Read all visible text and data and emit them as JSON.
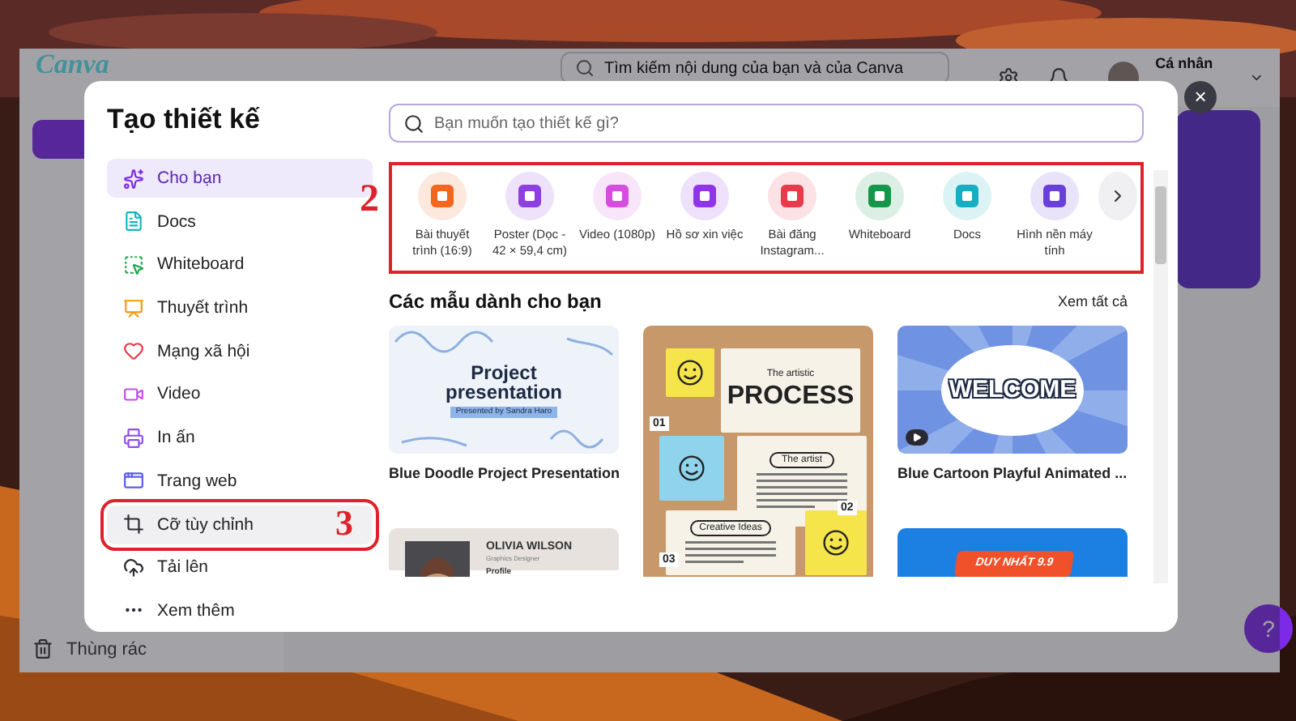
{
  "app": {
    "logo": "Canva",
    "search": {
      "placeholder": "Tìm kiếm nội dung của bạn và của Canva"
    },
    "account": "Cá nhân",
    "trash": "Thùng rác",
    "help": "?"
  },
  "dialog": {
    "title": "Tạo thiết kế",
    "close": "×",
    "nav": [
      {
        "label": "Cho bạn",
        "color": "#7d2ae8",
        "selected": true,
        "highlighted": false
      },
      {
        "label": "Docs",
        "color": "#13b5c6",
        "selected": false,
        "highlighted": false
      },
      {
        "label": "Whiteboard",
        "color": "#1fa64e",
        "selected": false,
        "highlighted": false
      },
      {
        "label": "Thuyết trình",
        "color": "#f59a0c",
        "selected": false,
        "highlighted": false
      },
      {
        "label": "Mạng xã hội",
        "color": "#e8394a",
        "selected": false,
        "highlighted": false
      },
      {
        "label": "Video",
        "color": "#c54ee8",
        "selected": false,
        "highlighted": false
      },
      {
        "label": "In ấn",
        "color": "#8d4ee8",
        "selected": false,
        "highlighted": false
      },
      {
        "label": "Trang web",
        "color": "#5a5ee8",
        "selected": false,
        "highlighted": false
      },
      {
        "label": "Cỡ tùy chỉnh",
        "color": "#2a2a33",
        "selected": false,
        "highlighted": true,
        "annotation": "3"
      },
      {
        "label": "Tải lên",
        "color": "#2a2a33",
        "selected": false,
        "highlighted": false
      },
      {
        "label": "Xem thêm",
        "color": "#2a2a33",
        "selected": false,
        "highlighted": false
      }
    ],
    "search": {
      "placeholder": "Bạn muốn tạo thiết kế gì?"
    },
    "categories": {
      "annotation": "2",
      "items": [
        {
          "label": "Bài thuyết trình (16:9)",
          "color": "#f2661e"
        },
        {
          "label": "Poster (Dọc - 42 × 59,4 cm)",
          "color": "#8e3fe0"
        },
        {
          "label": "Video (1080p)",
          "color": "#d54ee0"
        },
        {
          "label": "Hồ sơ xin việc",
          "color": "#9034e8"
        },
        {
          "label": "Bài đăng Instagram...",
          "color": "#e83a4a"
        },
        {
          "label": "Whiteboard",
          "color": "#15964a"
        },
        {
          "label": "Docs",
          "color": "#16aec0"
        },
        {
          "label": "Hình nền máy tính",
          "color": "#6a40d8"
        }
      ]
    },
    "templates_heading": "Các mẫu dành cho bạn",
    "see_all": "Xem tất cả",
    "templates": [
      {
        "kind": "doodle",
        "texts": [
          "Project presentation",
          "Presented by Sandra Haro"
        ],
        "caption": "Blue Doodle Project Presentation"
      },
      {
        "kind": "corkboard",
        "texts": [
          "The artistic",
          "PROCESS",
          "01",
          "The artist",
          "Creative Ideas",
          "02",
          "03"
        ]
      },
      {
        "kind": "welcome",
        "texts": [
          "WELCOME"
        ],
        "caption": "Blue Cartoon Playful Animated ..."
      },
      {
        "kind": "resume",
        "texts": [
          "OLIVIA WILSON",
          "Graphics Designer",
          "Profile"
        ]
      },
      {
        "kind": "sale",
        "texts": [
          "DUY NHẤT 9.9"
        ]
      }
    ]
  }
}
